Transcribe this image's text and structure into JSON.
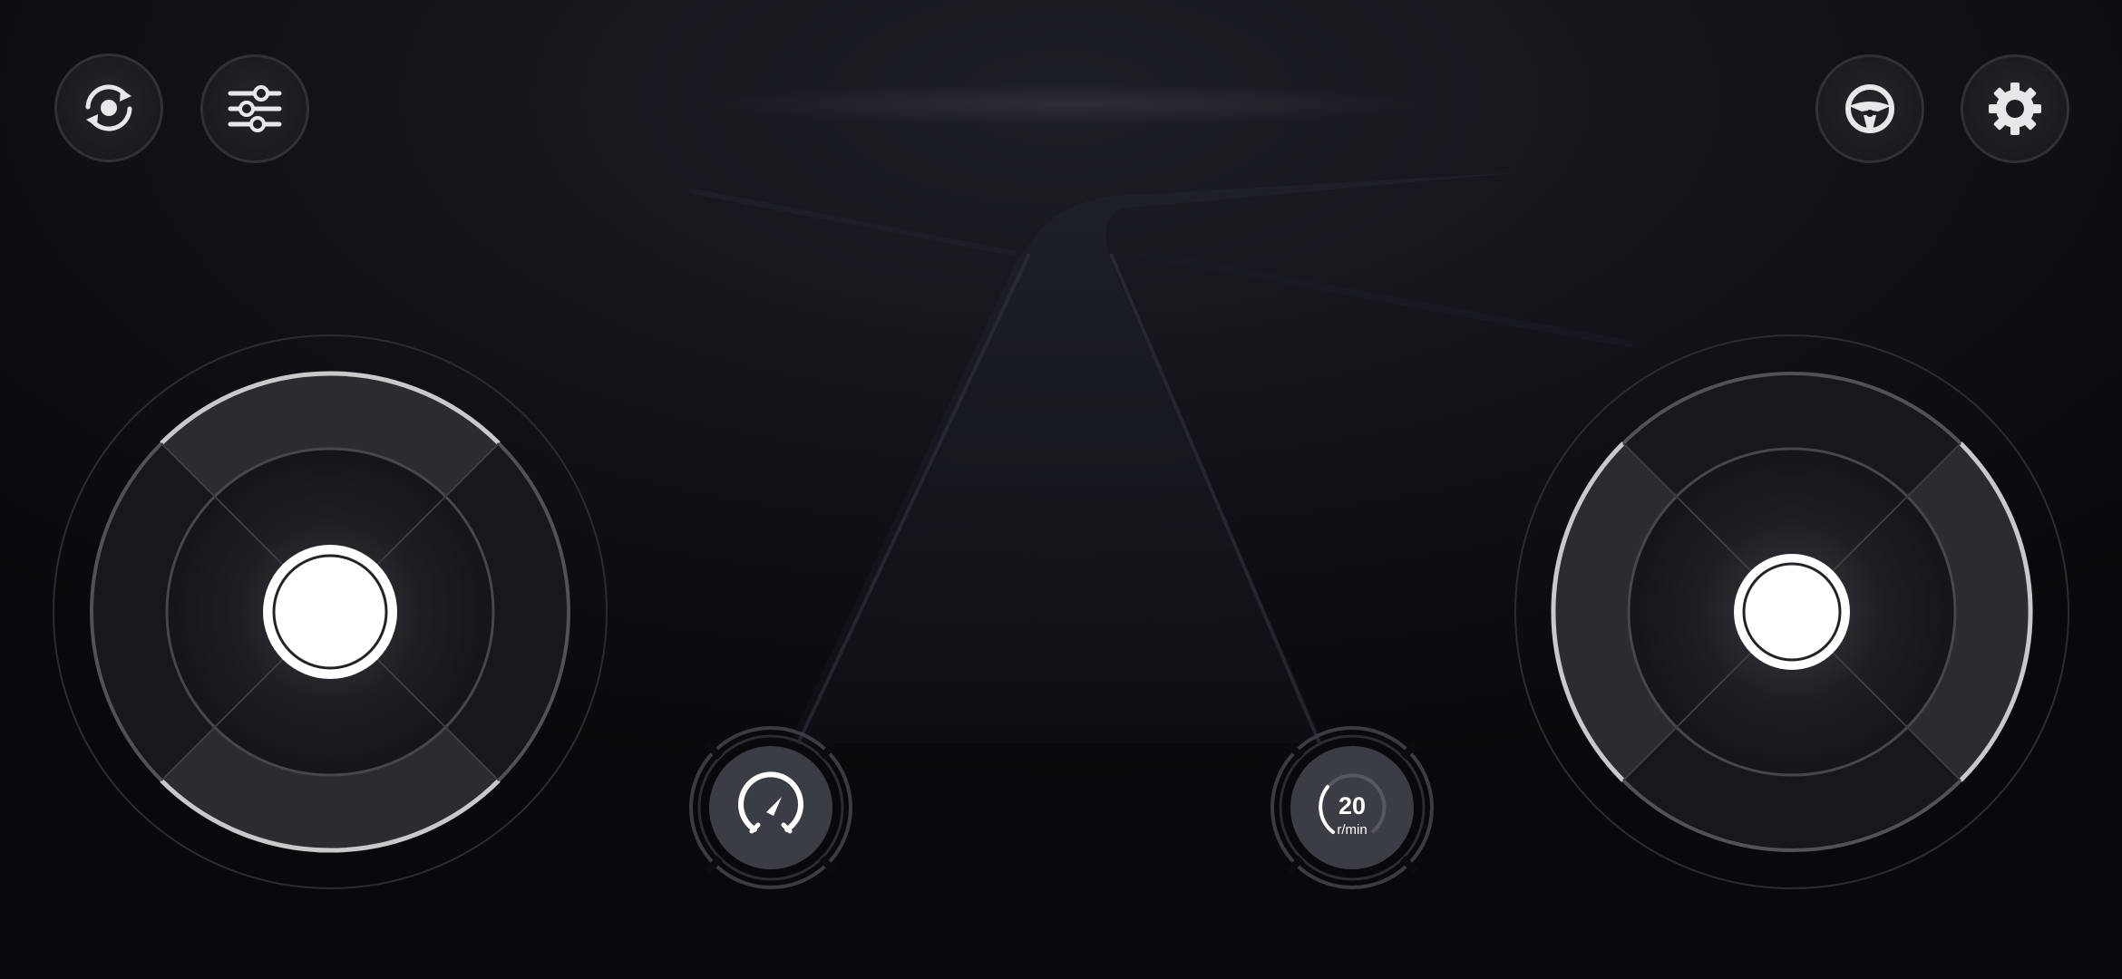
{
  "top_left_buttons": [
    {
      "icon": "rotate-camera-icon"
    },
    {
      "icon": "sliders-icon"
    }
  ],
  "top_right_buttons": [
    {
      "icon": "steering-wheel-icon"
    },
    {
      "icon": "gear-icon"
    }
  ],
  "left_joystick": {
    "axis": "vertical"
  },
  "right_joystick": {
    "axis": "horizontal"
  },
  "speed_gauge": {
    "icon": "speedometer-icon"
  },
  "rpm_gauge": {
    "value": "20",
    "unit": "r/min"
  },
  "colors": {
    "background": "#0b0c10",
    "button_fill": "#1c1d22",
    "ring": "#3a3c42",
    "highlight": "#d9d9dc",
    "knob": "#ffffff",
    "gauge_fill": "#3a3d44"
  }
}
